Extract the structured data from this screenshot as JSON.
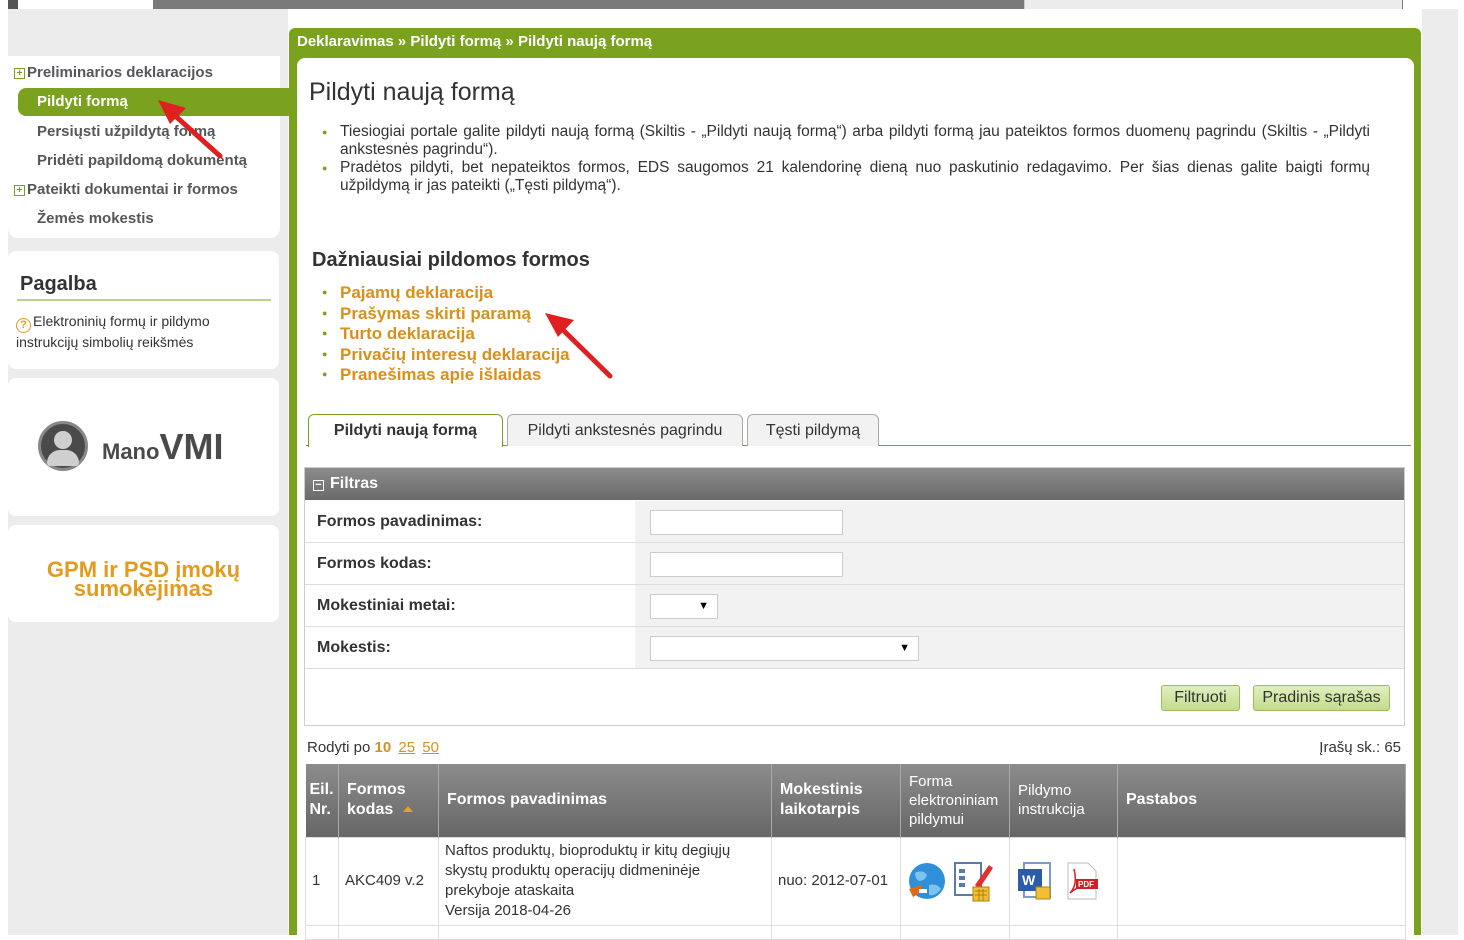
{
  "breadcrumb": "Deklaravimas » Pildyti formą » Pildyti naują formą",
  "nav": {
    "items": [
      {
        "label": "Preliminarios deklaracijos",
        "expandable": true
      },
      {
        "label": "Pildyti formą",
        "active": true
      },
      {
        "label": "Persiųsti užpildytą formą"
      },
      {
        "label": "Pridėti papildomą dokumentą"
      },
      {
        "label": "Pateikti dokumentai ir formos",
        "expandable": true
      },
      {
        "label": "Žemės mokestis"
      }
    ]
  },
  "help": {
    "title": "Pagalba",
    "link": "Elektroninių formų ir pildymo instrukcijų simbolių reikšmės"
  },
  "logo": {
    "mano": "Mano",
    "vmi": "VMI"
  },
  "gpm": {
    "line1": "GPM ir PSD įmokų",
    "line2": "sumokėjimas"
  },
  "page": {
    "title": "Pildyti naują formą",
    "intro": [
      "Tiesiogiai portale galite pildyti naują formą (Skiltis - „Pildyti naują formą“) arba pildyti formą jau pateiktos formos duomenų pagrindu (Skiltis - „Pildyti ankstesnės pagrindu“).",
      "Pradėtos pildyti, bet nepateiktos formos, EDS saugomos 21 kalendorinę dieną nuo paskutinio redagavimo. Per šias dienas galite baigti formų užpildymą ir jas pateikti („Tęsti pildymą“)."
    ],
    "frequent_title": "Dažniausiai pildomos formos",
    "frequent": [
      "Pajamų deklaracija",
      "Prašymas skirti paramą",
      "Turto deklaracija",
      "Privačių interesų deklaracija",
      "Pranešimas apie išlaidas"
    ]
  },
  "tabs": [
    "Pildyti naują formą",
    "Pildyti ankstesnės pagrindu",
    "Tęsti pildymą"
  ],
  "filter": {
    "title": "Filtras",
    "fields": [
      {
        "label": "Formos pavadinimas:",
        "type": "text",
        "value": ""
      },
      {
        "label": "Formos kodas:",
        "type": "text",
        "value": ""
      },
      {
        "label": "Mokestiniai metai:",
        "type": "select",
        "value": ""
      },
      {
        "label": "Mokestis:",
        "type": "select",
        "value": ""
      }
    ],
    "btn_filter": "Filtruoti",
    "btn_reset": "Pradinis sąrašas"
  },
  "paging": {
    "label": "Rodyti po",
    "current": "10",
    "options": [
      "25",
      "50"
    ],
    "count_label": "Įrašų sk.: 65"
  },
  "table": {
    "columns": [
      "Eil. Nr.",
      "Formos kodas",
      "Formos pavadinimas",
      "Mokestinis laikotarpis",
      "Forma elektroniniam pildymui",
      "Pildymo instrukcija",
      "Pastabos"
    ],
    "rows": [
      {
        "nr": "1",
        "code": "AKC409 v.2",
        "name": "Naftos produktų, bioproduktų ir kitų degiųjų skystų produktų operacijų didmeninėje prekyboje ataskaita",
        "version": "Versija 2018-04-26",
        "period": "nuo: 2012-07-01",
        "notes": ""
      }
    ]
  },
  "colors": {
    "green": "#7aa21f",
    "orange": "#d8901a",
    "header_gray": "#7a7a7a",
    "annotation_red": "#e02020"
  }
}
